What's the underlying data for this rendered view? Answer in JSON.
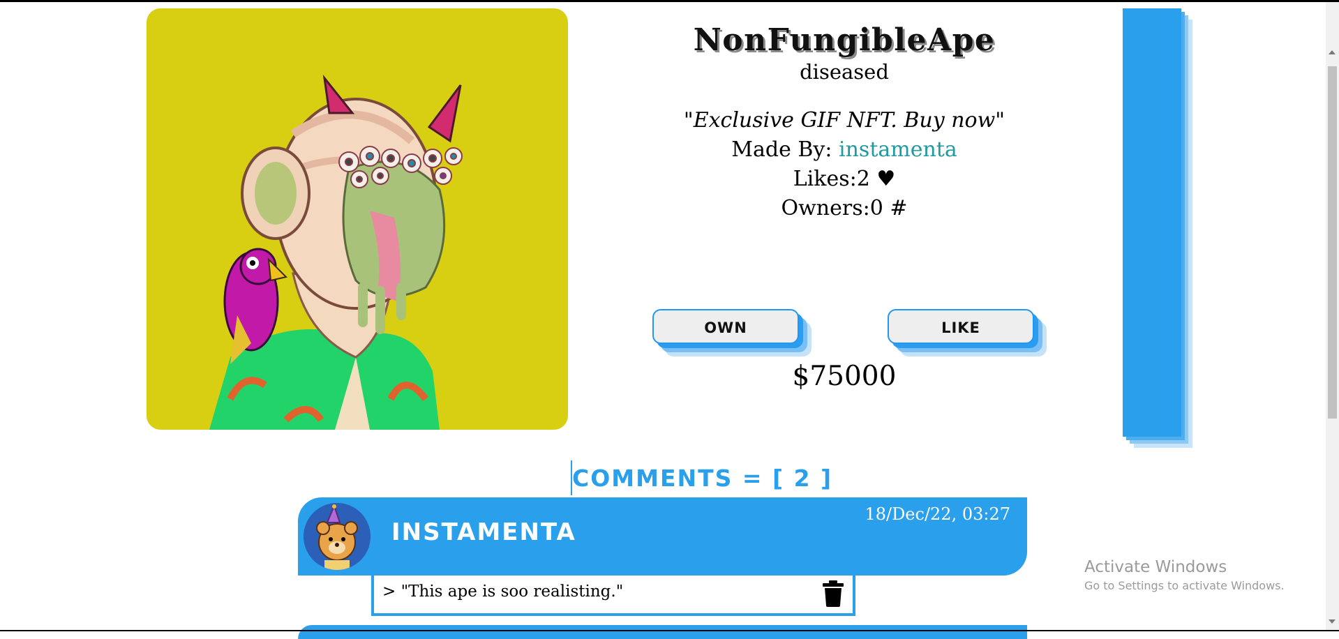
{
  "nft": {
    "title": "NonFungibleApe",
    "subtitle": "diseased",
    "description": "\"Exclusive GIF NFT. Buy now\"",
    "made_by_label": "Made By: ",
    "made_by_user": "instamenta",
    "likes_text": "Likes:2 ♥",
    "owners_text": "Owners:0 #",
    "price": "$75000",
    "image_icon": "ape-nft-image"
  },
  "actions": {
    "own_label": "OWN",
    "like_label": "LIKE"
  },
  "comments": {
    "heading": "COMMENTS = [ 2 ]",
    "items": [
      {
        "user": "INSTAMENTA",
        "date": "18/Dec/22, 03:27",
        "text": "> \"This ape is soo realisting.\"",
        "avatar_icon": "bear-avatar-icon",
        "delete_icon": "trash-icon"
      }
    ]
  },
  "watermark": {
    "title": "Activate Windows",
    "subtitle": "Go to Settings to activate Windows."
  },
  "colors": {
    "accent": "#2a9fec",
    "image_background": "#d8cf12",
    "link": "#1e9aa0"
  }
}
